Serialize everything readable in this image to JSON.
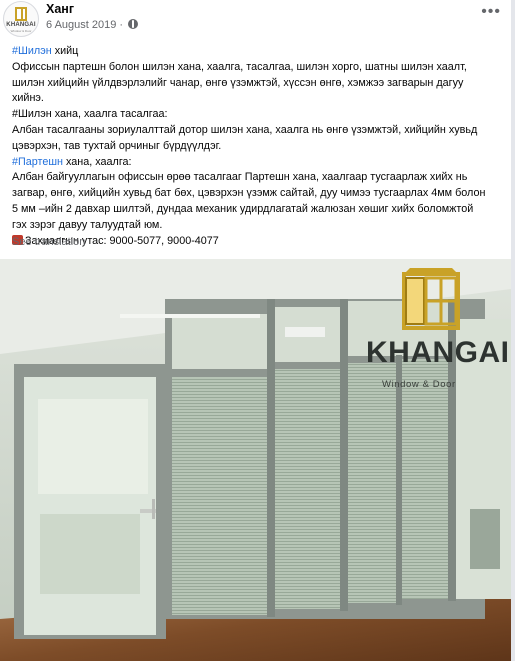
{
  "post": {
    "page_name": "Ханг",
    "date": "6 August 2019",
    "avatar_text": "KHANGAI",
    "avatar_sub": "Window & Door"
  },
  "content": {
    "p1_hashtag": "#Шилэн",
    "p1_rest": " хийц",
    "p2": "Офиссын партешн болон шилэн хана, хаалга, тасалгаа, шилэн хорго, шатны шилэн хаалт,",
    "p3": "шилэн хийцийн үйлдвэрлэлийг чанар, өнгө үзэмжтэй, хүссэн өнгө, хэмжээ загварын дагуу",
    "p4": "хийнэ.",
    "p5": "#Шилэн хана, хаалга тасалгаа:",
    "p6": "Албан тасалгааны зориулалттай дотор шилэн хана, хаалга нь өнгө үзэмжтэй, хийцийн хувьд",
    "p7": "цэвэрхэн, тав тухтай орчиныг бүрдүүлдэг.",
    "p8_hashtag": "#Партешн",
    "p8_rest": " хана, хаалга:",
    "p9": "Албан байгууллагын офиссын өрөө тасалгааг Партешн хана, хаалгаар тусгаарлаж хийх нь",
    "p10": "загвар, өнгө, хийцийн хувьд бат бөх, цэвэрхэн үзэмж сайтай, дуу чимээ тусгаарлах 4мм болон",
    "p11": "5 мм –ийн 2 давхар шилтэй, дундаа механик удирдлагатай жалюзан хөшиг хийх боломжтой",
    "p12": "гэх зэрэг давуу талуудтай юм.",
    "p13": "Захиалгын утас: 9000-5077, 9000-4077"
  },
  "see_translation": "See translation",
  "photo": {
    "logo_text": "KHANGAI",
    "logo_sub": "Window & Door",
    "colors": {
      "logo_gold": "#c9a227",
      "floor": "#8a5a33",
      "frame": "#8e9690",
      "wall": "#c8d2c6"
    }
  },
  "icons": [
    "globe-icon",
    "more-options-icon",
    "phone-icon"
  ]
}
